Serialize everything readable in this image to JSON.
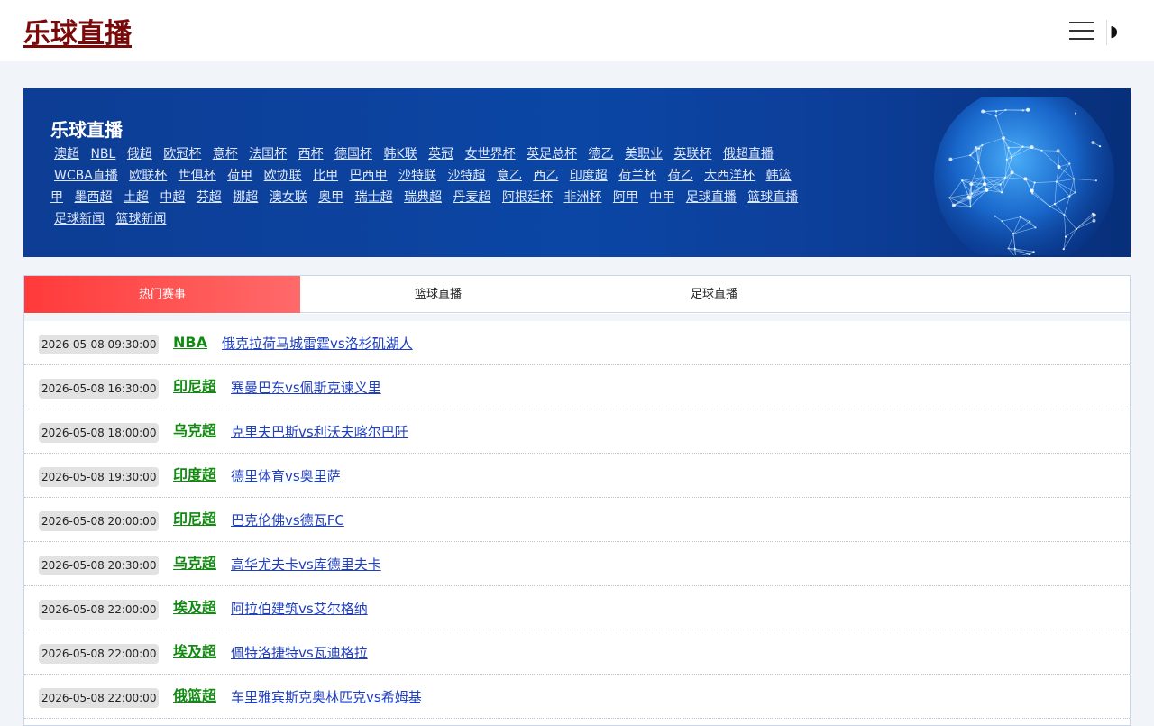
{
  "header": {
    "logo": "乐球直播",
    "menu_icon": "hamburger-menu-icon",
    "theme_icon": "half-moon-icon",
    "theme_glyph": "◗"
  },
  "banner": {
    "title": "乐球直播",
    "links": [
      "澳超",
      "NBL",
      "俄超",
      "欧冠杯",
      "意杯",
      "法国杯",
      "西杯",
      "德国杯",
      "韩K联",
      "英冠",
      "女世界杯",
      "英足总杯",
      "德乙",
      "美职业",
      "英联杯",
      "俄超直播",
      "WCBA直播",
      "欧联杯",
      "世俱杯",
      "荷甲",
      "欧协联",
      "比甲",
      "巴西甲",
      "沙特联",
      "沙特超",
      "意乙",
      "西乙",
      "印度超",
      "荷兰杯",
      "荷乙",
      "大西洋杯",
      "韩篮甲",
      "墨西超",
      "土超",
      "中超",
      "芬超",
      "挪超",
      "澳女联",
      "奥甲",
      "瑞士超",
      "瑞典超",
      "丹麦超",
      "阿根廷杯",
      "非洲杯",
      "阿甲",
      "中甲",
      "足球直播",
      "篮球直播",
      "足球新闻",
      "篮球新闻"
    ]
  },
  "tabs": [
    {
      "label": "热门赛事",
      "active": true
    },
    {
      "label": "篮球直播",
      "active": false
    },
    {
      "label": "足球直播",
      "active": false
    }
  ],
  "matches": [
    {
      "time": "2026-05-08 09:30:00",
      "league": "NBA",
      "title": "俄克拉荷马城雷霆vs洛杉矶湖人"
    },
    {
      "time": "2026-05-08 16:30:00",
      "league": "印尼超",
      "title": "塞曼巴东vs佩斯克谏义里"
    },
    {
      "time": "2026-05-08 18:00:00",
      "league": "乌克超",
      "title": "克里夫巴斯vs利沃夫喀尔巴阡"
    },
    {
      "time": "2026-05-08 19:30:00",
      "league": "印度超",
      "title": "德里体育vs奥里萨"
    },
    {
      "time": "2026-05-08 20:00:00",
      "league": "印尼超",
      "title": "巴克伦佛vs德瓦FC"
    },
    {
      "time": "2026-05-08 20:30:00",
      "league": "乌克超",
      "title": "高华尤夫卡vs库德里夫卡"
    },
    {
      "time": "2026-05-08 22:00:00",
      "league": "埃及超",
      "title": "阿拉伯建筑vs艾尔格纳"
    },
    {
      "time": "2026-05-08 22:00:00",
      "league": "埃及超",
      "title": "佩特洛捷特vs瓦迪格拉"
    },
    {
      "time": "2026-05-08 22:00:00",
      "league": "俄篮超",
      "title": "车里雅宾斯克奥林匹克vs希姆基"
    }
  ],
  "colors": {
    "logo": "#7a0a0a",
    "league": "#118a11",
    "match_link": "#1f3fbf",
    "tab_active_start": "#ff3a3a",
    "tab_active_end": "#ff6a6a",
    "banner": "#0b46a5"
  }
}
